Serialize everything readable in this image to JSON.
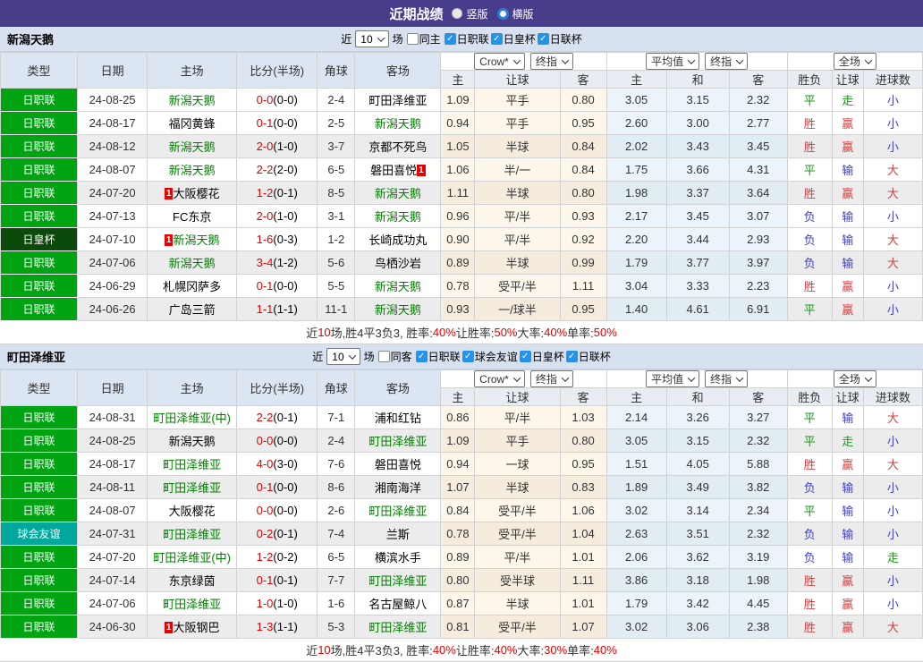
{
  "header": {
    "title": "近期战绩",
    "vertical": "竖版",
    "horizontal": "横版"
  },
  "labels": {
    "near": "近",
    "games": "场"
  },
  "columns": {
    "type": "类型",
    "date": "日期",
    "home": "主场",
    "score": "比分(半场)",
    "corner": "角球",
    "away": "客场",
    "crow": "Crow*",
    "final": "终指",
    "avg": "平均值",
    "full": "全场",
    "o_home": "主",
    "o_hd": "让球",
    "o_away": "客",
    "a_home": "主",
    "a_draw": "和",
    "a_away": "客",
    "wdl": "胜负",
    "hd_res": "让球",
    "goals": "进球数"
  },
  "sections": [
    {
      "team": "新潟天鹅",
      "count": "10",
      "same": "同主",
      "leagues": [
        "日职联",
        "日皇杯",
        "日联杯"
      ],
      "rows": [
        {
          "t": "日职联",
          "tc": "league",
          "d": "24-08-25",
          "hb": "",
          "h": "新潟天鹅",
          "hc": "green",
          "s": "0-0",
          "sh": "(0-0)",
          "c": "2-4",
          "a": "町田泽维亚",
          "ac": "",
          "ab": "",
          "o1": "1.09",
          "hd": "平手",
          "o2": "0.80",
          "m1": "3.05",
          "m2": "3.15",
          "m3": "2.32",
          "r1": "平",
          "r1c": "green",
          "r2": "走",
          "r2c": "green",
          "r3": "小",
          "r3c": "blue",
          "z": ""
        },
        {
          "t": "日职联",
          "tc": "league",
          "d": "24-08-17",
          "hb": "",
          "h": "福冈黄蜂",
          "hc": "",
          "s": "0-1",
          "sh": "(0-0)",
          "c": "2-5",
          "a": "新潟天鹅",
          "ac": "green",
          "ab": "",
          "o1": "0.94",
          "hd": "平手",
          "o2": "0.95",
          "m1": "2.60",
          "m2": "3.00",
          "m3": "2.77",
          "r1": "胜",
          "r1c": "red",
          "r2": "赢",
          "r2c": "red",
          "r3": "小",
          "r3c": "blue",
          "z": ""
        },
        {
          "t": "日职联",
          "tc": "league",
          "d": "24-08-12",
          "hb": "",
          "h": "新潟天鹅",
          "hc": "green",
          "s": "2-0",
          "sh": "(1-0)",
          "c": "3-7",
          "a": "京都不死鸟",
          "ac": "",
          "ab": "",
          "o1": "1.05",
          "hd": "半球",
          "o2": "0.84",
          "m1": "2.02",
          "m2": "3.43",
          "m3": "3.45",
          "r1": "胜",
          "r1c": "red",
          "r2": "赢",
          "r2c": "red",
          "r3": "小",
          "r3c": "blue",
          "z": "shaded"
        },
        {
          "t": "日职联",
          "tc": "league",
          "d": "24-08-07",
          "hb": "",
          "h": "新潟天鹅",
          "hc": "green",
          "s": "2-2",
          "sh": "(2-0)",
          "c": "6-5",
          "a": "磐田喜悦",
          "ac": "",
          "ab": "1",
          "o1": "1.06",
          "hd": "半/一",
          "o2": "0.84",
          "m1": "1.75",
          "m2": "3.66",
          "m3": "4.31",
          "r1": "平",
          "r1c": "green",
          "r2": "输",
          "r2c": "blue",
          "r3": "大",
          "r3c": "red",
          "z": ""
        },
        {
          "t": "日职联",
          "tc": "league",
          "d": "24-07-20",
          "hb": "1",
          "h": "大阪樱花",
          "hc": "",
          "s": "1-2",
          "sh": "(0-1)",
          "c": "8-5",
          "a": "新潟天鹅",
          "ac": "green",
          "ab": "",
          "o1": "1.11",
          "hd": "半球",
          "o2": "0.80",
          "m1": "1.98",
          "m2": "3.37",
          "m3": "3.64",
          "r1": "胜",
          "r1c": "red",
          "r2": "赢",
          "r2c": "red",
          "r3": "大",
          "r3c": "red",
          "z": "shaded"
        },
        {
          "t": "日职联",
          "tc": "league",
          "d": "24-07-13",
          "hb": "",
          "h": "FC东京",
          "hc": "",
          "s": "2-0",
          "sh": "(1-0)",
          "c": "3-1",
          "a": "新潟天鹅",
          "ac": "green",
          "ab": "",
          "o1": "0.96",
          "hd": "平/半",
          "o2": "0.93",
          "m1": "2.17",
          "m2": "3.45",
          "m3": "3.07",
          "r1": "负",
          "r1c": "blue",
          "r2": "输",
          "r2c": "blue",
          "r3": "小",
          "r3c": "blue",
          "z": ""
        },
        {
          "t": "日皇杯",
          "tc": "cup",
          "d": "24-07-10",
          "hb": "1",
          "h": "新潟天鹅",
          "hc": "green",
          "s": "1-6",
          "sh": "(0-3)",
          "c": "1-2",
          "a": "长崎成功丸",
          "ac": "",
          "ab": "",
          "o1": "0.90",
          "hd": "平/半",
          "o2": "0.92",
          "m1": "2.20",
          "m2": "3.44",
          "m3": "2.93",
          "r1": "负",
          "r1c": "blue",
          "r2": "输",
          "r2c": "blue",
          "r3": "大",
          "r3c": "red",
          "z": ""
        },
        {
          "t": "日职联",
          "tc": "league",
          "d": "24-07-06",
          "hb": "",
          "h": "新潟天鹅",
          "hc": "green",
          "s": "3-4",
          "sh": "(1-2)",
          "c": "5-6",
          "a": "鸟栖沙岩",
          "ac": "",
          "ab": "",
          "o1": "0.89",
          "hd": "半球",
          "o2": "0.99",
          "m1": "1.79",
          "m2": "3.77",
          "m3": "3.97",
          "r1": "负",
          "r1c": "blue",
          "r2": "输",
          "r2c": "blue",
          "r3": "大",
          "r3c": "red",
          "z": "shaded"
        },
        {
          "t": "日职联",
          "tc": "league",
          "d": "24-06-29",
          "hb": "",
          "h": "札幌冈萨多",
          "hc": "",
          "s": "0-1",
          "sh": "(0-0)",
          "c": "5-5",
          "a": "新潟天鹅",
          "ac": "green",
          "ab": "",
          "o1": "0.78",
          "hd": "受平/半",
          "o2": "1.11",
          "m1": "3.04",
          "m2": "3.33",
          "m3": "2.23",
          "r1": "胜",
          "r1c": "red",
          "r2": "赢",
          "r2c": "red",
          "r3": "小",
          "r3c": "blue",
          "z": ""
        },
        {
          "t": "日职联",
          "tc": "league",
          "d": "24-06-26",
          "hb": "",
          "h": "广岛三箭",
          "hc": "",
          "s": "1-1",
          "sh": "(1-1)",
          "c": "11-1",
          "a": "新潟天鹅",
          "ac": "green",
          "ab": "",
          "o1": "0.93",
          "hd": "一/球半",
          "o2": "0.95",
          "m1": "1.40",
          "m2": "4.61",
          "m3": "6.91",
          "r1": "平",
          "r1c": "green",
          "r2": "赢",
          "r2c": "red",
          "r3": "小",
          "r3c": "blue",
          "z": "shaded"
        }
      ],
      "summary": [
        {
          "t": "近",
          "c": "k"
        },
        {
          "t": "10",
          "c": "r"
        },
        {
          "t": "场,胜4平3负3, 胜率:",
          "c": "k"
        },
        {
          "t": "40%",
          "c": "r"
        },
        {
          "t": " 让胜率:",
          "c": "k"
        },
        {
          "t": "50%",
          "c": "r"
        },
        {
          "t": " 大率:",
          "c": "k"
        },
        {
          "t": "40%",
          "c": "r"
        },
        {
          "t": " 单率:",
          "c": "k"
        },
        {
          "t": "50%",
          "c": "r"
        }
      ]
    },
    {
      "team": "町田泽维亚",
      "count": "10",
      "same": "同客",
      "leagues": [
        "日职联",
        "球会友谊",
        "日皇杯",
        "日联杯"
      ],
      "rows": [
        {
          "t": "日职联",
          "tc": "league",
          "d": "24-08-31",
          "hb": "",
          "h": "町田泽维亚(中)",
          "hc": "green",
          "s": "2-2",
          "sh": "(0-1)",
          "c": "7-1",
          "a": "浦和红钻",
          "ac": "",
          "ab": "",
          "o1": "0.86",
          "hd": "平/半",
          "o2": "1.03",
          "m1": "2.14",
          "m2": "3.26",
          "m3": "3.27",
          "r1": "平",
          "r1c": "green",
          "r2": "输",
          "r2c": "blue",
          "r3": "大",
          "r3c": "red",
          "z": ""
        },
        {
          "t": "日职联",
          "tc": "league",
          "d": "24-08-25",
          "hb": "",
          "h": "新潟天鹅",
          "hc": "",
          "s": "0-0",
          "sh": "(0-0)",
          "c": "2-4",
          "a": "町田泽维亚",
          "ac": "green",
          "ab": "",
          "o1": "1.09",
          "hd": "平手",
          "o2": "0.80",
          "m1": "3.05",
          "m2": "3.15",
          "m3": "2.32",
          "r1": "平",
          "r1c": "green",
          "r2": "走",
          "r2c": "green",
          "r3": "小",
          "r3c": "blue",
          "z": "shaded"
        },
        {
          "t": "日职联",
          "tc": "league",
          "d": "24-08-17",
          "hb": "",
          "h": "町田泽维亚",
          "hc": "green",
          "s": "4-0",
          "sh": "(3-0)",
          "c": "7-6",
          "a": "磐田喜悦",
          "ac": "",
          "ab": "",
          "o1": "0.94",
          "hd": "一球",
          "o2": "0.95",
          "m1": "1.51",
          "m2": "4.05",
          "m3": "5.88",
          "r1": "胜",
          "r1c": "red",
          "r2": "赢",
          "r2c": "red",
          "r3": "大",
          "r3c": "red",
          "z": ""
        },
        {
          "t": "日职联",
          "tc": "league",
          "d": "24-08-11",
          "hb": "",
          "h": "町田泽维亚",
          "hc": "green",
          "s": "0-1",
          "sh": "(0-0)",
          "c": "8-6",
          "a": "湘南海洋",
          "ac": "",
          "ab": "",
          "o1": "1.07",
          "hd": "半球",
          "o2": "0.83",
          "m1": "1.89",
          "m2": "3.49",
          "m3": "3.82",
          "r1": "负",
          "r1c": "blue",
          "r2": "输",
          "r2c": "blue",
          "r3": "小",
          "r3c": "blue",
          "z": "shaded"
        },
        {
          "t": "日职联",
          "tc": "league",
          "d": "24-08-07",
          "hb": "",
          "h": "大阪樱花",
          "hc": "",
          "s": "0-0",
          "sh": "(0-0)",
          "c": "2-6",
          "a": "町田泽维亚",
          "ac": "green",
          "ab": "",
          "o1": "0.84",
          "hd": "受平/半",
          "o2": "1.06",
          "m1": "3.02",
          "m2": "3.14",
          "m3": "2.34",
          "r1": "平",
          "r1c": "green",
          "r2": "输",
          "r2c": "blue",
          "r3": "小",
          "r3c": "blue",
          "z": ""
        },
        {
          "t": "球会友谊",
          "tc": "friendly",
          "d": "24-07-31",
          "hb": "",
          "h": "町田泽维亚",
          "hc": "green",
          "s": "0-2",
          "sh": "(0-1)",
          "c": "7-4",
          "a": "兰斯",
          "ac": "",
          "ab": "",
          "o1": "0.78",
          "hd": "受平/半",
          "o2": "1.04",
          "m1": "2.63",
          "m2": "3.51",
          "m3": "2.32",
          "r1": "负",
          "r1c": "blue",
          "r2": "输",
          "r2c": "blue",
          "r3": "小",
          "r3c": "blue",
          "z": "shaded"
        },
        {
          "t": "日职联",
          "tc": "league",
          "d": "24-07-20",
          "hb": "",
          "h": "町田泽维亚(中)",
          "hc": "green",
          "s": "1-2",
          "sh": "(0-2)",
          "c": "6-5",
          "a": "横滨水手",
          "ac": "",
          "ab": "",
          "o1": "0.89",
          "hd": "平/半",
          "o2": "1.01",
          "m1": "2.06",
          "m2": "3.62",
          "m3": "3.19",
          "r1": "负",
          "r1c": "blue",
          "r2": "输",
          "r2c": "blue",
          "r3": "走",
          "r3c": "green",
          "z": ""
        },
        {
          "t": "日职联",
          "tc": "league",
          "d": "24-07-14",
          "hb": "",
          "h": "东京绿茵",
          "hc": "",
          "s": "0-1",
          "sh": "(0-1)",
          "c": "7-7",
          "a": "町田泽维亚",
          "ac": "green",
          "ab": "",
          "o1": "0.80",
          "hd": "受半球",
          "o2": "1.11",
          "m1": "3.86",
          "m2": "3.18",
          "m3": "1.98",
          "r1": "胜",
          "r1c": "red",
          "r2": "赢",
          "r2c": "red",
          "r3": "小",
          "r3c": "blue",
          "z": "shaded"
        },
        {
          "t": "日职联",
          "tc": "league",
          "d": "24-07-06",
          "hb": "",
          "h": "町田泽维亚",
          "hc": "green",
          "s": "1-0",
          "sh": "(1-0)",
          "c": "1-6",
          "a": "名古屋鲸八",
          "ac": "",
          "ab": "",
          "o1": "0.87",
          "hd": "半球",
          "o2": "1.01",
          "m1": "1.79",
          "m2": "3.42",
          "m3": "4.45",
          "r1": "胜",
          "r1c": "red",
          "r2": "赢",
          "r2c": "red",
          "r3": "小",
          "r3c": "blue",
          "z": ""
        },
        {
          "t": "日职联",
          "tc": "league",
          "d": "24-06-30",
          "hb": "1",
          "h": "大阪钢巴",
          "hc": "",
          "s": "1-3",
          "sh": "(1-1)",
          "c": "5-3",
          "a": "町田泽维亚",
          "ac": "green",
          "ab": "",
          "o1": "0.81",
          "hd": "受平/半",
          "o2": "1.07",
          "m1": "3.02",
          "m2": "3.06",
          "m3": "2.38",
          "r1": "胜",
          "r1c": "red",
          "r2": "赢",
          "r2c": "red",
          "r3": "大",
          "r3c": "red",
          "z": "shaded"
        }
      ],
      "summary": [
        {
          "t": "近",
          "c": "k"
        },
        {
          "t": "10",
          "c": "r"
        },
        {
          "t": "场,胜4平3负3, 胜率:",
          "c": "k"
        },
        {
          "t": "40%",
          "c": "r"
        },
        {
          "t": " 让胜率:",
          "c": "k"
        },
        {
          "t": "40%",
          "c": "r"
        },
        {
          "t": " 大率:",
          "c": "k"
        },
        {
          "t": "30%",
          "c": "r"
        },
        {
          "t": " 单率:",
          "c": "k"
        },
        {
          "t": "40%",
          "c": "r"
        }
      ]
    }
  ]
}
